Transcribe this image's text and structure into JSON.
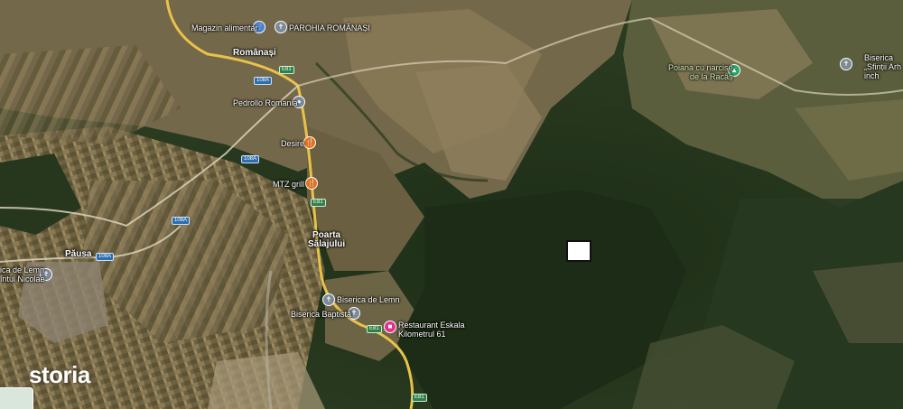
{
  "brand": {
    "logo_text": "storia"
  },
  "places": [
    {
      "id": "magazin",
      "label": "Magazin alimentar",
      "icon": "shopping-cart-icon"
    },
    {
      "id": "parohia",
      "label": "PAROHIA ROMÂNAȘI",
      "icon": "church-icon"
    },
    {
      "id": "romanasi",
      "label": "Românași"
    },
    {
      "id": "pedrollo",
      "label": "Pedrollo Romania",
      "icon": "place-pin-icon"
    },
    {
      "id": "desire",
      "label": "Desire",
      "icon": "restaurant-icon"
    },
    {
      "id": "mtz",
      "label": "MTZ grill",
      "icon": "restaurant-icon"
    },
    {
      "id": "poarta",
      "label": "Poarta\nSălajului"
    },
    {
      "id": "pausa",
      "label": "Păusa"
    },
    {
      "id": "biserica_lemn_left",
      "label": "ica de Lemn\nîntul Nicolae",
      "icon": "church-icon"
    },
    {
      "id": "biserica_lemn",
      "label": "Biserica de Lemn",
      "icon": "church-icon"
    },
    {
      "id": "biserica_baptista",
      "label": "Biserica Baptistă",
      "icon": "church-icon"
    },
    {
      "id": "restaurant",
      "label": "Restaurant Eskala\nKilometrul 61",
      "icon": "bed-icon"
    },
    {
      "id": "poiana",
      "label": "Poiana cu narcise\nde la Racâș",
      "icon": "park-icon"
    },
    {
      "id": "biserica_right",
      "label": "Biserica\n„Sfinții Arh\ninch",
      "icon": "church-icon"
    }
  ],
  "roads": {
    "r108a": "108A",
    "e81": "E81"
  },
  "colors": {
    "forest": "#22331a",
    "field": "#7a6a48",
    "road": "#e8c24a",
    "accent": "#e0318f"
  }
}
